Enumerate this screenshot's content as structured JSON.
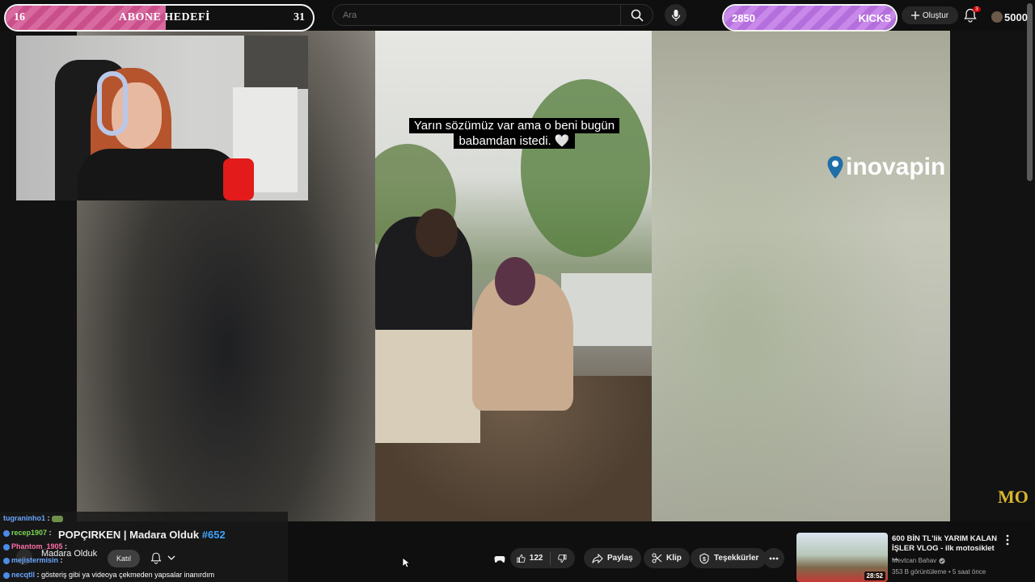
{
  "overlay": {
    "sub_goal": {
      "current": "16",
      "title": "ABONE HEDEFİ",
      "target": "31",
      "progress": 0.52
    },
    "kicks_goal": {
      "current": "2850",
      "title": "KICKS",
      "progress": 1.0
    },
    "coins": "5000",
    "notification_count": "3"
  },
  "header": {
    "search_placeholder": "Ara",
    "create_label": "Oluştur"
  },
  "video": {
    "caption": "Yarın sözümüz var ama o beni bugün babamdan istedi. 🤍",
    "sponsor_logo": "inovapin",
    "corner_logo": "MO"
  },
  "chat": [
    {
      "user": "tugraninho1",
      "msg": ""
    },
    {
      "user": "recep1907",
      "msg": ""
    },
    {
      "user": "Phantom_1905",
      "msg": ""
    },
    {
      "user": "mejistermisin",
      "msg": ""
    },
    {
      "user": "necqtll",
      "msg": "gösteriş gibi ya videoya çekmeden yapsalar inanırdım"
    }
  ],
  "stream": {
    "title_prefix": "POPÇIRKEN | Madara Olduk",
    "episode": "#652",
    "channel_name": "Madara Olduk",
    "join_label": "Katıl"
  },
  "actions": {
    "likes": "122",
    "share_label": "Paylaş",
    "clip_label": "Klip",
    "thanks_label": "Teşekkürler"
  },
  "recommended": {
    "title": "600 BİN TL'lik YARIM KALAN İŞLER VLOG - ilk motosiklet ...",
    "channel": "Mevtcan Bahav",
    "meta": "353 B görüntüleme • 5 saat önce",
    "duration": "28:52"
  },
  "colors": {
    "accent_link": "#3ea6ff",
    "sub_goal_fill": "#c94f8b",
    "kicks_fill": "#b46fdc",
    "logo_gold": "#d8b62e"
  }
}
